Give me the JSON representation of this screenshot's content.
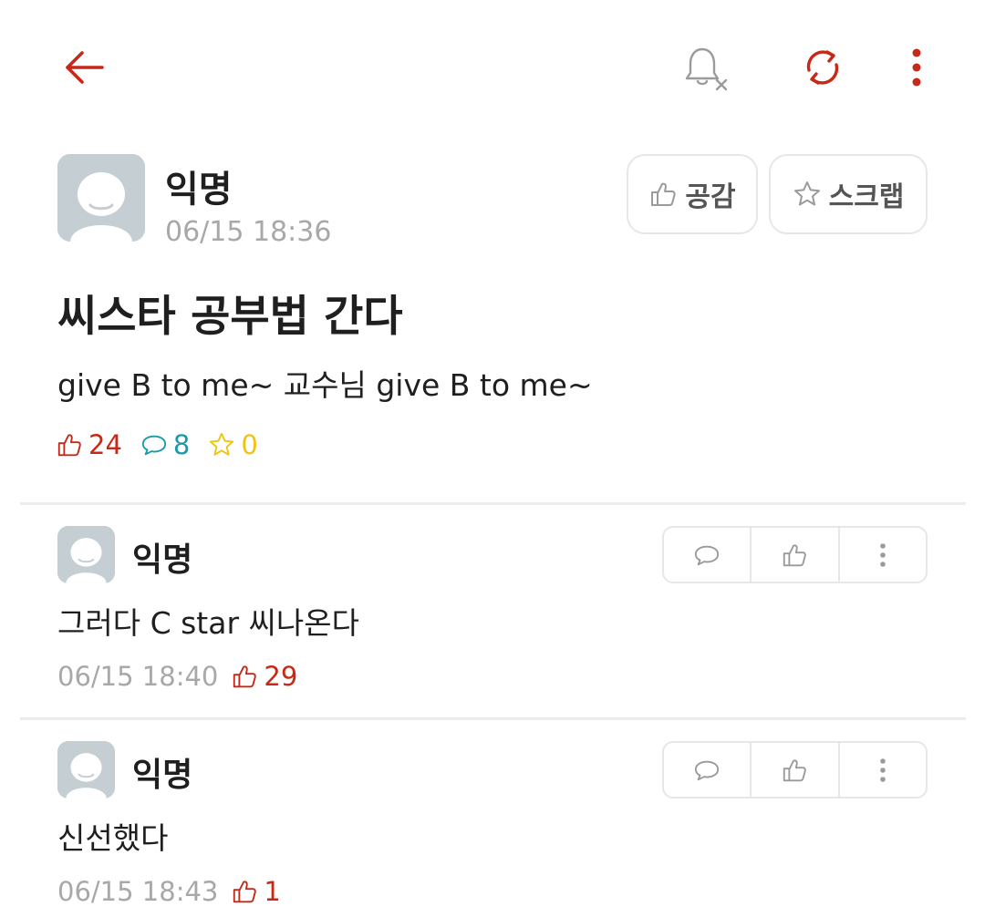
{
  "colors": {
    "accent": "#c62917",
    "comment_accent": "#1a9aa8",
    "scrap_accent": "#f1c40f",
    "muted_text": "#a8a8a8",
    "border": "#e7e7e7"
  },
  "toolbar": {
    "back_icon": "arrow-left-icon",
    "notification_icon": "bell-off-icon",
    "refresh_icon": "refresh-icon",
    "more_icon": "more-vertical-icon"
  },
  "post": {
    "author": "익명",
    "time": "06/15 18:36",
    "like_button_label": "공감",
    "scrap_button_label": "스크랩",
    "title": "씨스타 공부법 간다",
    "body": "give B to me~ 교수님 give B to me~",
    "likes": "24",
    "comments": "8",
    "scraps": "0"
  },
  "comments": [
    {
      "author": "익명",
      "text": "그러다 C star 씨나온다",
      "time": "06/15 18:40",
      "likes": "29"
    },
    {
      "author": "익명",
      "text": "신선했다",
      "time": "06/15 18:43",
      "likes": "1"
    }
  ]
}
